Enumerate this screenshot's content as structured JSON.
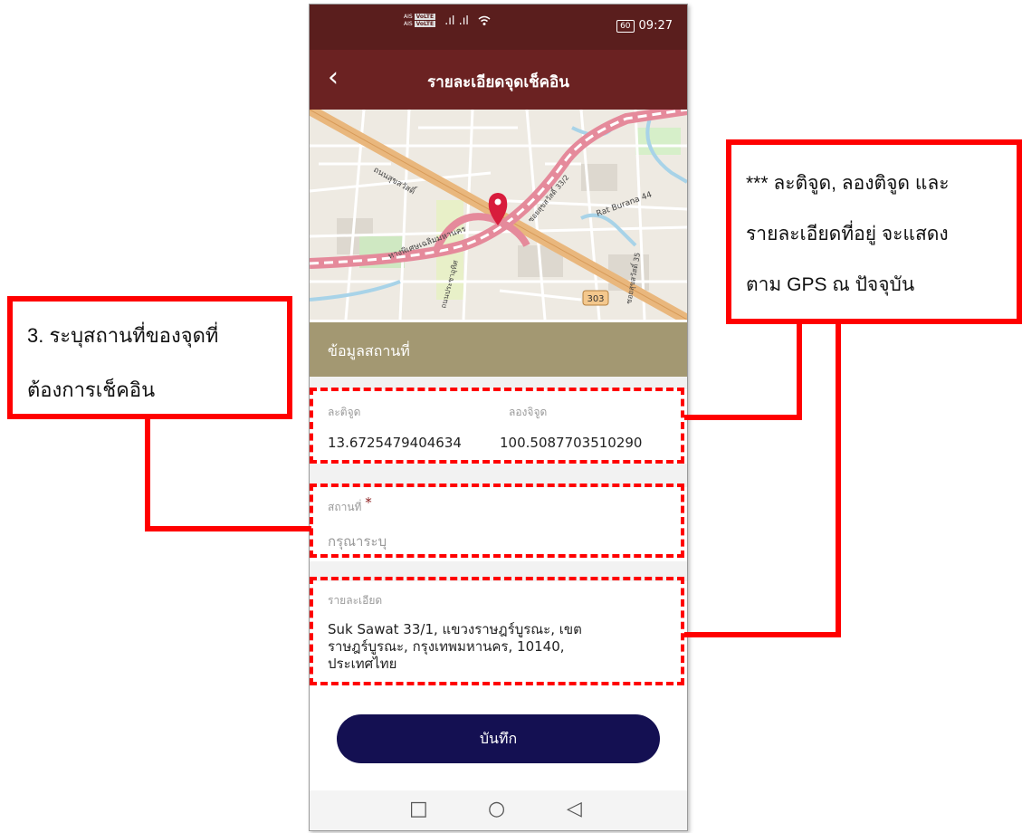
{
  "colors": {
    "statusbar": "#5a1e1d",
    "appbar": "#6b2222",
    "section": "#a39872",
    "button": "#141052",
    "annotation": "#ff0000",
    "required": "#8b1c1c"
  },
  "status_bar": {
    "carrier_top": "AIS",
    "carrier_top_badge": "VoLTE",
    "carrier_bottom": "AIS",
    "carrier_bottom_badge": "VoLTE",
    "signal": ".ıl .ıl",
    "wifi_icon": "wifi-icon",
    "battery": "60",
    "time": "09:27"
  },
  "app_bar": {
    "back_icon": "back-arrow-icon",
    "title": "รายละเอียดจุดเช็คอิน"
  },
  "map": {
    "labels": [
      "ถนนสุขสวัสดิ์",
      "ทางพิเศษเฉลิมมหานคร",
      "Rat Burana 44",
      "303",
      "ซอยสุขสวัสดิ์ 33/2",
      "ถนนประชาอุทิศ",
      "ซอยสุขสวัสดิ์ 35"
    ],
    "pin_icon": "map-pin-icon"
  },
  "section_header": "ข้อมูลสถานที่",
  "location": {
    "lat_label": "ละติจูด",
    "lat_value": "13.6725479404634",
    "lng_label": "ลองจิจูด",
    "lng_value": "100.5087703510290"
  },
  "place": {
    "label": "สถานที่",
    "required_mark": "*",
    "placeholder": "กรุณาระบุ"
  },
  "details": {
    "label": "รายละเอียด",
    "line1": "Suk Sawat 33/1, แขวงราษฎร์บูรณะ, เขต",
    "line2": "ราษฎร์บูรณะ, กรุงเทพมหานคร, 10140,",
    "line3": "ประเทศไทย"
  },
  "save_button": "บันทึก",
  "nav": {
    "recents": "□",
    "home": "○",
    "back": "◁"
  },
  "annotations": {
    "left_line1": "3. ระบุสถานที่ของจุดที่",
    "left_line2": "ต้องการเช็คอิน",
    "right_line1": "*** ละติจูด, ลองติจูด และ",
    "right_line2": "รายละเอียดที่อยู่ จะแสดง",
    "right_line3": "ตาม GPS ณ ปัจจุบัน"
  }
}
